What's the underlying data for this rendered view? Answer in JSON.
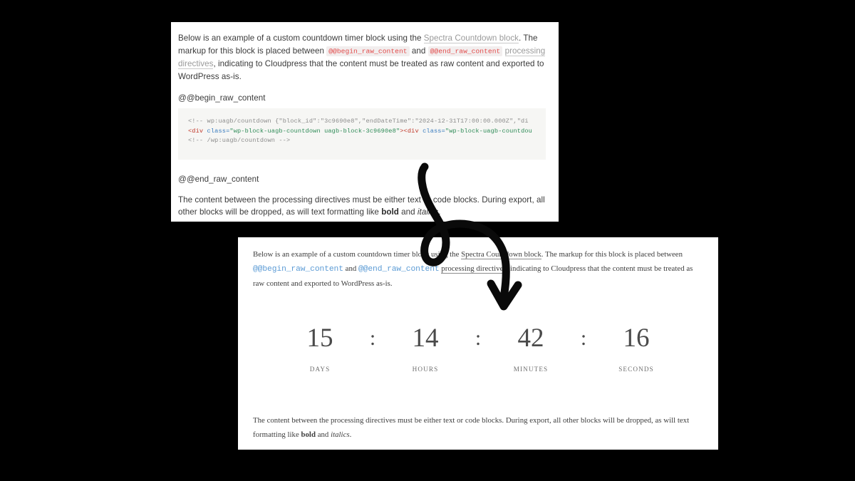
{
  "editor_panel": {
    "intro_paragraph": {
      "part1": "Below is an example of a custom countdown timer block using the ",
      "link_text": "Spectra Countdown block",
      "part2": ". The markup for this block is placed between ",
      "code1": "@@begin_raw_content",
      "part3": " and ",
      "code2": "@@end_raw_content",
      "part4": " ",
      "link2_text": "processing directives",
      "part5": ", indicating to Cloudpress that the content must be treated as raw content and exported to WordPress as-is."
    },
    "begin_directive": "@@begin_raw_content",
    "end_directive": "@@end_raw_content",
    "code_block": {
      "line1": {
        "comment_open": "<!-- wp:uagb/countdown ",
        "json": "{\"block_id\":\"3c9690e8\",\"endDateTime\":\"2024-12-31T17:00:00.000Z\",\"di"
      },
      "line2": {
        "tag_open": "<div ",
        "attr": "class=",
        "value": "\"wp-block-uagb-countdown uagb-block-3c9690e8\"",
        "gt": ">",
        "tag_open2": "<div ",
        "attr2": "class=",
        "value2": "\"wp-block-uagb-countdou"
      },
      "line3": "<!-- /wp:uagb/countdown -->"
    },
    "closing_paragraph": {
      "part1": "The content between the processing directives must be either text or code blocks. During export, all other blocks will be dropped, as will text formatting like ",
      "bold": "bold",
      "part2": " and ",
      "italic": "italics",
      "part3": "."
    }
  },
  "wp_panel": {
    "intro_paragraph": {
      "part1": "Below is an example of a custom countdown timer block using the ",
      "link_text": "Spectra Countdown block",
      "part2": ". The markup for this block is placed between ",
      "code1": "@@begin_raw_content",
      "part3": " and ",
      "code2": "@@end_raw_content",
      "part4": " ",
      "link2_text": "processing directives",
      "part5": ", indicating to Cloudpress that the content must be treated as raw content and exported to WordPress as-is."
    },
    "countdown": {
      "separator": ":",
      "units": [
        {
          "value": "15",
          "label": "DAYS"
        },
        {
          "value": "14",
          "label": "HOURS"
        },
        {
          "value": "42",
          "label": "MINUTES"
        },
        {
          "value": "16",
          "label": "SECONDS"
        }
      ]
    },
    "closing_paragraph": {
      "part1": "The content between the processing directives must be either text or code blocks. During export, all other blocks will be dropped, as will text formatting like ",
      "bold": "bold",
      "part2": " and ",
      "italic": "italics",
      "part3": "."
    }
  },
  "colors": {
    "background": "#000000",
    "panel": "#ffffff",
    "code_block_bg": "#f6f6f4",
    "inline_code_text": "#e24b4b",
    "inline_code_bg": "#f2eeee",
    "wp_code_text": "#5b9bd5",
    "annotation": "#0a0a0a"
  },
  "annotation": {
    "icon": "curved-loop-arrow-down"
  }
}
